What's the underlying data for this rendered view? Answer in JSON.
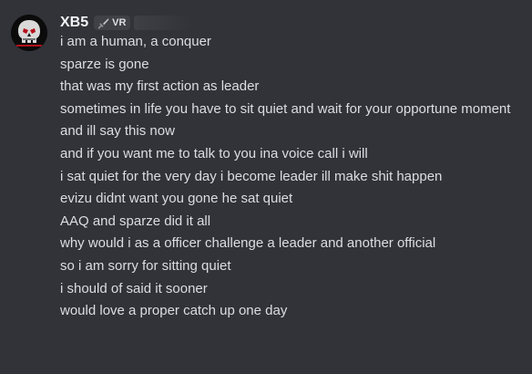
{
  "author": {
    "name": "XB5",
    "tag": "VR",
    "tag_icon": "sword-icon"
  },
  "messages": [
    "i am a human, a conquer",
    "sparze is gone",
    "that was my first action as leader",
    "sometimes in life you have to sit quiet and wait for your opportune moment",
    "and ill say this now",
    "and if you want me to talk to you ina voice call i will",
    "i sat quiet for the very day i become leader ill make shit happen",
    "evizu didnt want you gone he sat quiet",
    "AAQ and sparze did it all",
    "why would i as a officer challenge a leader and another official",
    "so i am sorry for sitting quiet",
    "i should of said it sooner",
    "would love a proper catch up one day"
  ],
  "colors": {
    "background": "#313338",
    "username": "#f2f3f5",
    "text": "#dbdee1",
    "tag_bg": "#3f4147"
  }
}
